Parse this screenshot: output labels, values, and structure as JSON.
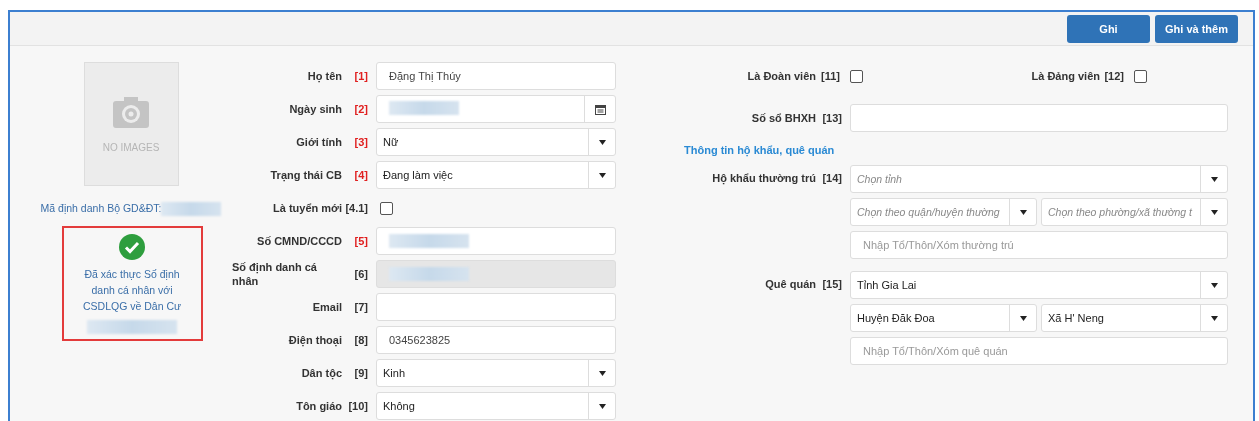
{
  "toolbar": {
    "buttons": [
      "Ghi",
      "Ghi và thêm"
    ]
  },
  "photo": {
    "caption": "NO IMAGES"
  },
  "id_label": {
    "text": "Mã định danh Bộ GD&ĐT:",
    "redacted": true
  },
  "verification": {
    "verified": true,
    "message": "Đã xác thực Số định danh cá nhân với CSDLQG về Dân Cư",
    "redacted": true
  },
  "fields": [
    {
      "label": "Họ tên",
      "tag": "[1]",
      "required": true,
      "kind": "text",
      "value": "Đặng Thị Thúy",
      "redacted": false
    },
    {
      "label": "Ngày sinh",
      "tag": "[2]",
      "required": true,
      "kind": "date",
      "redacted": true
    },
    {
      "label": "Giới tính",
      "tag": "[3]",
      "required": true,
      "kind": "select",
      "value": "Nữ",
      "redacted": false
    },
    {
      "label": "Trạng thái CB",
      "tag": "[4]",
      "required": true,
      "kind": "select",
      "value": "Đang làm việc",
      "redacted": false
    },
    {
      "label": "Là tuyển mới",
      "tag": "[4.1]",
      "required": false,
      "kind": "checkbox",
      "checked": false
    },
    {
      "label": "Số CMND/CCCD",
      "tag": "[5]",
      "required": true,
      "kind": "text",
      "redacted": true
    },
    {
      "label": "Số định danh cá nhân",
      "tag": "[6]",
      "required": false,
      "kind": "readonly",
      "redacted": true
    },
    {
      "label": "Email",
      "tag": "[7]",
      "required": false,
      "kind": "text",
      "redacted": false
    },
    {
      "label": "Điện thoại",
      "tag": "[8]",
      "required": false,
      "kind": "text",
      "value": "0345623825",
      "redacted": false
    },
    {
      "label": "Dân tộc",
      "tag": "[9]",
      "required": false,
      "kind": "select",
      "value": "Kinh",
      "redacted": false
    },
    {
      "label": "Tôn giáo",
      "tag": "[10]",
      "required": false,
      "kind": "select",
      "value": "Không",
      "redacted": false
    }
  ],
  "flags": [
    {
      "label": "Là Đoàn viên",
      "tag": "[11]",
      "checked": false
    },
    {
      "label": "Là Đảng viên",
      "tag": "[12]",
      "checked": false
    }
  ],
  "bhxh": {
    "label": "Số sổ BHXH",
    "tag": "[13]"
  },
  "section_heading": "Thông tin hộ khẩu, quê quán",
  "addresses": [
    {
      "label": "Hộ khẩu thường trú",
      "tag": "[14]",
      "province": {
        "placeholder": "Chọn tỉnh"
      },
      "district": {
        "placeholder": "Chọn theo quận/huyện thường"
      },
      "ward": {
        "placeholder": "Chọn theo phường/xã thường t"
      },
      "village": {
        "placeholder": "Nhập Tổ/Thôn/Xóm thường trú"
      }
    },
    {
      "label": "Quê quán",
      "tag": "[15]",
      "province": {
        "value": "Tỉnh Gia Lai"
      },
      "district": {
        "value": "Huyện Đăk Đoa"
      },
      "ward": {
        "value": "Xã H' Neng"
      },
      "village": {
        "placeholder": "Nhập Tổ/Thôn/Xóm quê quán"
      }
    }
  ]
}
